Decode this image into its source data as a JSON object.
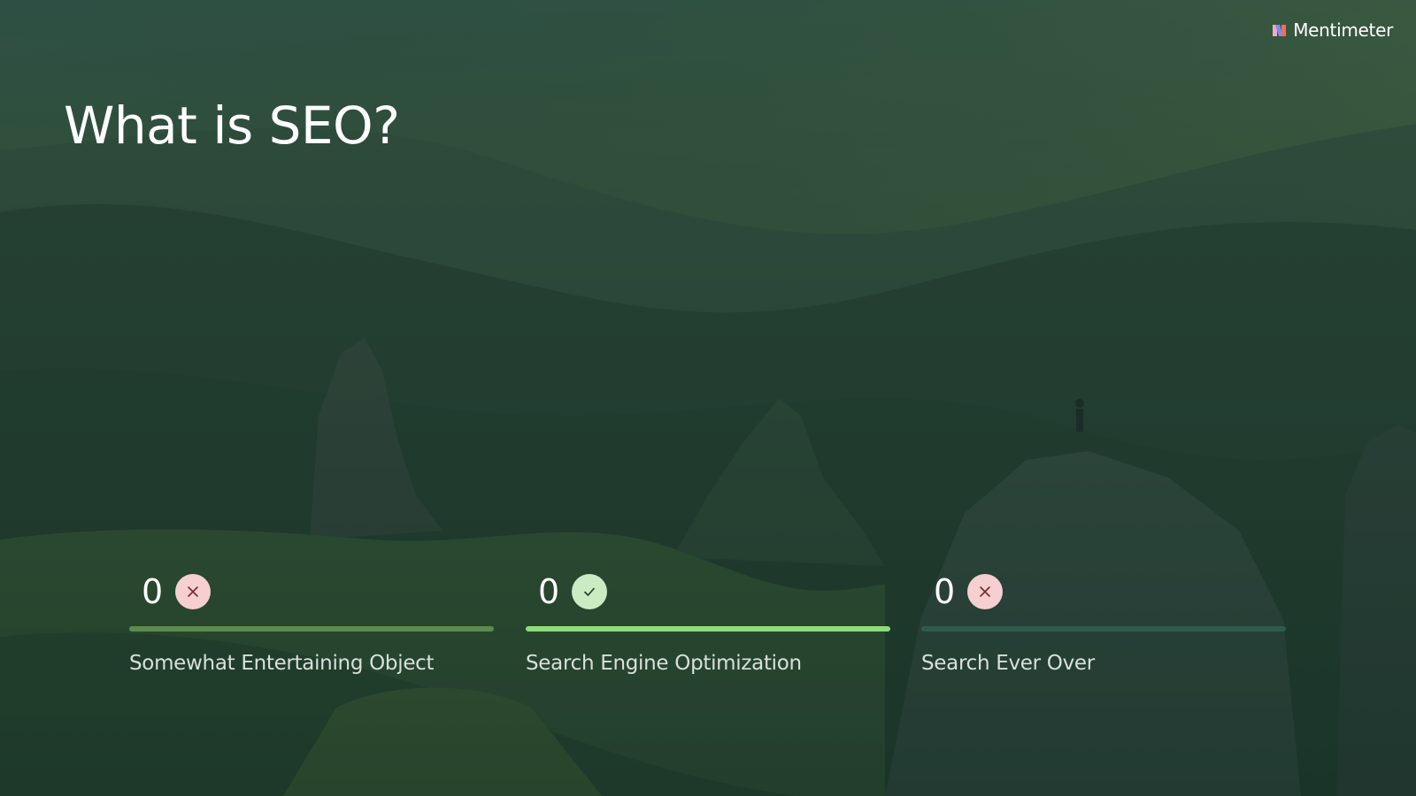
{
  "brand": {
    "name": "Mentimeter",
    "icon": "mentimeter-logo-icon"
  },
  "slide": {
    "title": "What is SEO?",
    "background_description_icon": "mountain-landscape-image"
  },
  "quiz": {
    "options": [
      {
        "label": "Somewhat Entertaining Object",
        "count": "0",
        "result": "incorrect",
        "result_icon": "close-icon",
        "bar_color": "#5f8a4f"
      },
      {
        "label": "Search Engine Optimization",
        "count": "0",
        "result": "correct",
        "result_icon": "check-icon",
        "bar_color": "#8fdd7a"
      },
      {
        "label": "Search Ever Over",
        "count": "0",
        "result": "incorrect",
        "result_icon": "close-icon",
        "bar_color": "#2f5a4c"
      }
    ]
  },
  "colors": {
    "incorrect_badge": "#f6cfd0",
    "correct_badge": "#c9ecc3",
    "text": "#ffffff"
  }
}
